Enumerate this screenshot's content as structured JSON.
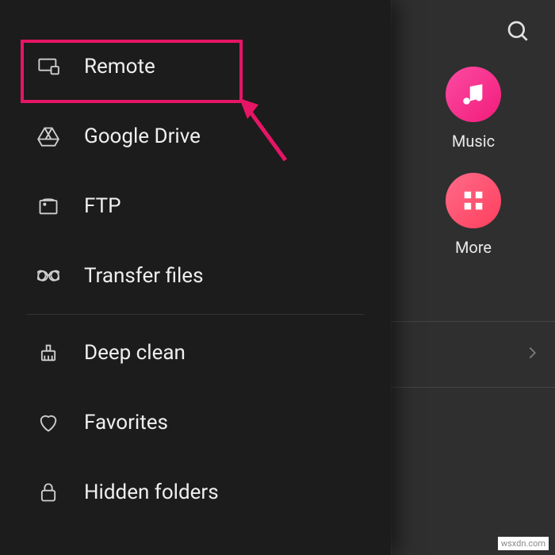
{
  "drawer": {
    "items": [
      {
        "label": "Remote",
        "icon": "monitor-icon"
      },
      {
        "label": "Google Drive",
        "icon": "gdrive-icon"
      },
      {
        "label": "FTP",
        "icon": "ftp-icon"
      },
      {
        "label": "Transfer files",
        "icon": "link-icon"
      },
      {
        "label": "Deep clean",
        "icon": "broom-icon"
      },
      {
        "label": "Favorites",
        "icon": "heart-icon"
      },
      {
        "label": "Hidden folders",
        "icon": "lock-icon"
      }
    ]
  },
  "shortcuts": {
    "music": {
      "label": "Music"
    },
    "more": {
      "label": "More"
    }
  },
  "highlight": {
    "color": "#e61565",
    "target": "sidebar-item-remote"
  },
  "watermark": "wsxdn.com"
}
